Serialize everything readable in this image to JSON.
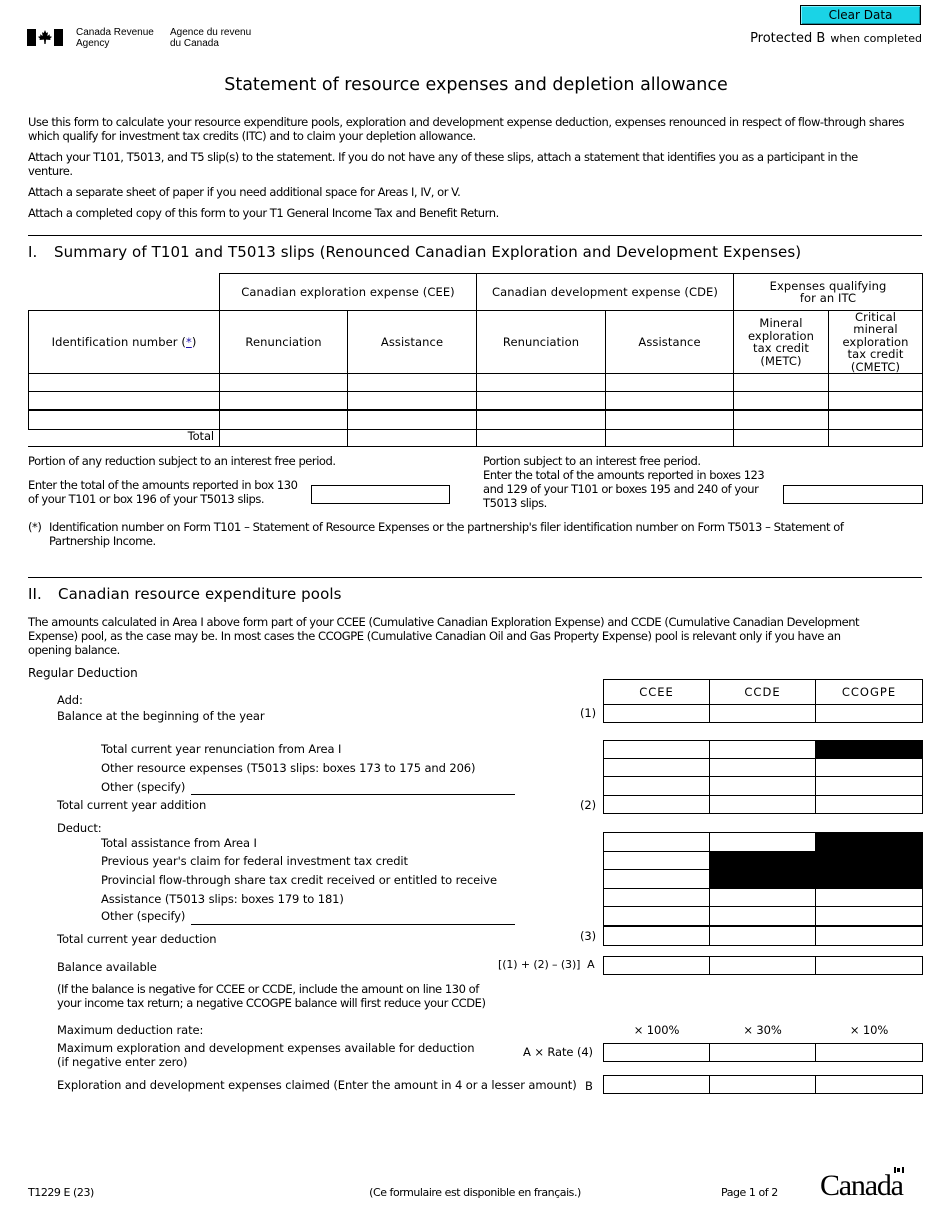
{
  "header": {
    "agency_en_line1": "Canada Revenue",
    "agency_en_line2": "Agency",
    "agency_fr_line1": "Agence du revenu",
    "agency_fr_line2": "du Canada",
    "clear_button": "Clear Data",
    "protected": "Protected B",
    "protected_suffix": "when completed",
    "flag_icon": "canada-flag-icon"
  },
  "title": "Statement of resource expenses and depletion allowance",
  "intro": [
    "Use this form to calculate your resource expenditure pools, exploration and development expense deduction, expenses renounced in respect of flow-through shares which qualify for investment tax credits (ITC) and to claim your depletion allowance.",
    "Attach your T101, T5013, and T5 slip(s) to the statement. If you do not have any of these slips, attach a statement that identifies you as a participant in the venture.",
    "Attach a separate sheet of paper if you need additional space for Areas I, IV, or V.",
    "Attach a completed copy of this form to your T1 General Income Tax and Benefit Return."
  ],
  "area1": {
    "number": "I.",
    "title": "Summary of T101 and T5013 slips (Renounced Canadian Exploration and Development Expenses)",
    "group_headers": {
      "cee": "Canadian exploration expense (CEE)",
      "cde": "Canadian development expense (CDE)",
      "itc": "Expenses qualifying for an ITC"
    },
    "columns": {
      "id": "Identification number (",
      "id_star": "*",
      "id_close": ")",
      "cee_renunciation": "Renunciation",
      "cee_assistance": "Assistance",
      "cde_renunciation": "Renunciation",
      "cde_assistance": "Assistance",
      "metc": "Mineral exploration tax credit (METC)",
      "cmetc": "Critical mineral exploration tax credit (CMETC)"
    },
    "rows": [
      {
        "id": "",
        "cee_ren": "",
        "cee_asst": "",
        "cde_ren": "",
        "cde_asst": "",
        "metc": "",
        "cmetc": ""
      },
      {
        "id": "",
        "cee_ren": "",
        "cee_asst": "",
        "cde_ren": "",
        "cde_asst": "",
        "metc": "",
        "cmetc": ""
      },
      {
        "id": "",
        "cee_ren": "",
        "cee_asst": "",
        "cde_ren": "",
        "cde_asst": "",
        "metc": "",
        "cmetc": ""
      }
    ],
    "total_label": "Total",
    "interest_left_title": "Portion of any reduction subject to an interest free period.",
    "interest_left_text1": "Enter the total of the amounts reported in box 130",
    "interest_left_text2": "of your T101 or box 196 of your T5013 slips.",
    "interest_left_value": "",
    "interest_right_title": "Portion subject to an interest free period.",
    "interest_right_text1": "Enter the total of the amounts reported in boxes 123",
    "interest_right_text2": "and 129 of your T101 or boxes 195 and 240 of your",
    "interest_right_text3": "T5013 slips.",
    "interest_right_value": "",
    "footnote_mark": "(*)",
    "footnote_line1": "Identification number on Form T101 – Statement of Resource Expenses or the partnership's filer identification number on Form T5013 – Statement of",
    "footnote_line2": "Partnership Income."
  },
  "area2": {
    "number": "II.",
    "title": "Canadian resource expenditure pools",
    "intro_line1": "The amounts calculated in Area I above form part of your CCEE (Cumulative Canadian Exploration Expense) and CCDE (Cumulative Canadian Development",
    "intro_line2": "Expense) pool, as the case may be. In most cases the CCOGPE (Cumulative Canadian Oil and Gas Property Expense) pool is relevant only if you have an",
    "intro_line3": "opening balance.",
    "regular_deduction": "Regular Deduction",
    "columns": [
      "CCEE",
      "CCDE",
      "CCOGPE"
    ],
    "add_label": "Add:",
    "balance_begin": "Balance at the beginning of the year",
    "line1": "(1)",
    "renunciation_area1": "Total current year renunciation from Area I",
    "other_resource": "Other resource expenses (T5013 slips: boxes 173 to 175 and 206)",
    "other_specify_add": "Other (specify)",
    "other_specify_add_value": "",
    "total_addition": "Total current year addition",
    "line2": "(2)",
    "deduct_label": "Deduct:",
    "total_assistance": "Total assistance from Area I",
    "prev_itc": "Previous year's claim for federal investment tax credit",
    "provincial_ft": "Provincial flow-through share tax credit received or entitled to receive",
    "assistance_t5013": "Assistance (T5013 slips: boxes 179 to 181)",
    "other_specify_deduct": "Other (specify)",
    "other_specify_deduct_value": "",
    "total_deduction": "Total current year deduction",
    "line3": "(3)",
    "balance_available": "Balance available",
    "balance_formula": "[(1) + (2) – (3)]",
    "line_a": "A",
    "negative_note1": "(If the balance is negative for CCEE or CCDE, include the amount on line 130 of",
    "negative_note2": "your income tax return; a negative CCOGPE balance will first reduce your CCDE)",
    "max_rate_label": "Maximum deduction rate:",
    "rates": [
      "× 100%",
      "× 30%",
      "× 10%"
    ],
    "max_available1": "Maximum exploration and development expenses available for deduction",
    "max_available2": "(if negative enter zero)",
    "max_formula": "A × Rate (4)",
    "claimed": "Exploration and development expenses claimed (Enter the amount in 4 or a lesser amount)",
    "line_b": "B"
  },
  "footer": {
    "form_code": "T1229 E (23)",
    "french_note": "(Ce formulaire est disponible en français.)",
    "page": "Page 1 of 2",
    "wordmark": "Canadä"
  }
}
